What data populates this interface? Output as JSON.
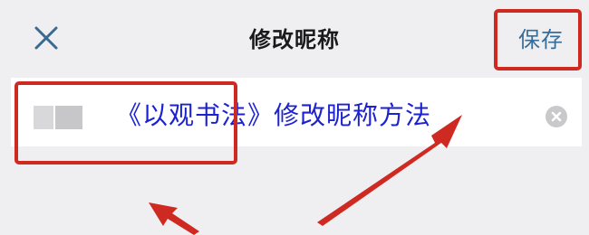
{
  "header": {
    "title": "修改昵称",
    "save_label": "保存",
    "close_icon": "close-icon"
  },
  "nickname_input": {
    "clear_icon": "clear-circle-icon"
  },
  "overlay": {
    "caption": "《以观书法》修改昵称方法"
  },
  "colors": {
    "background": "#efeff2",
    "save_text": "#356e9b",
    "caption_text": "#1c22d2",
    "annotation_red": "#cf2a22"
  }
}
